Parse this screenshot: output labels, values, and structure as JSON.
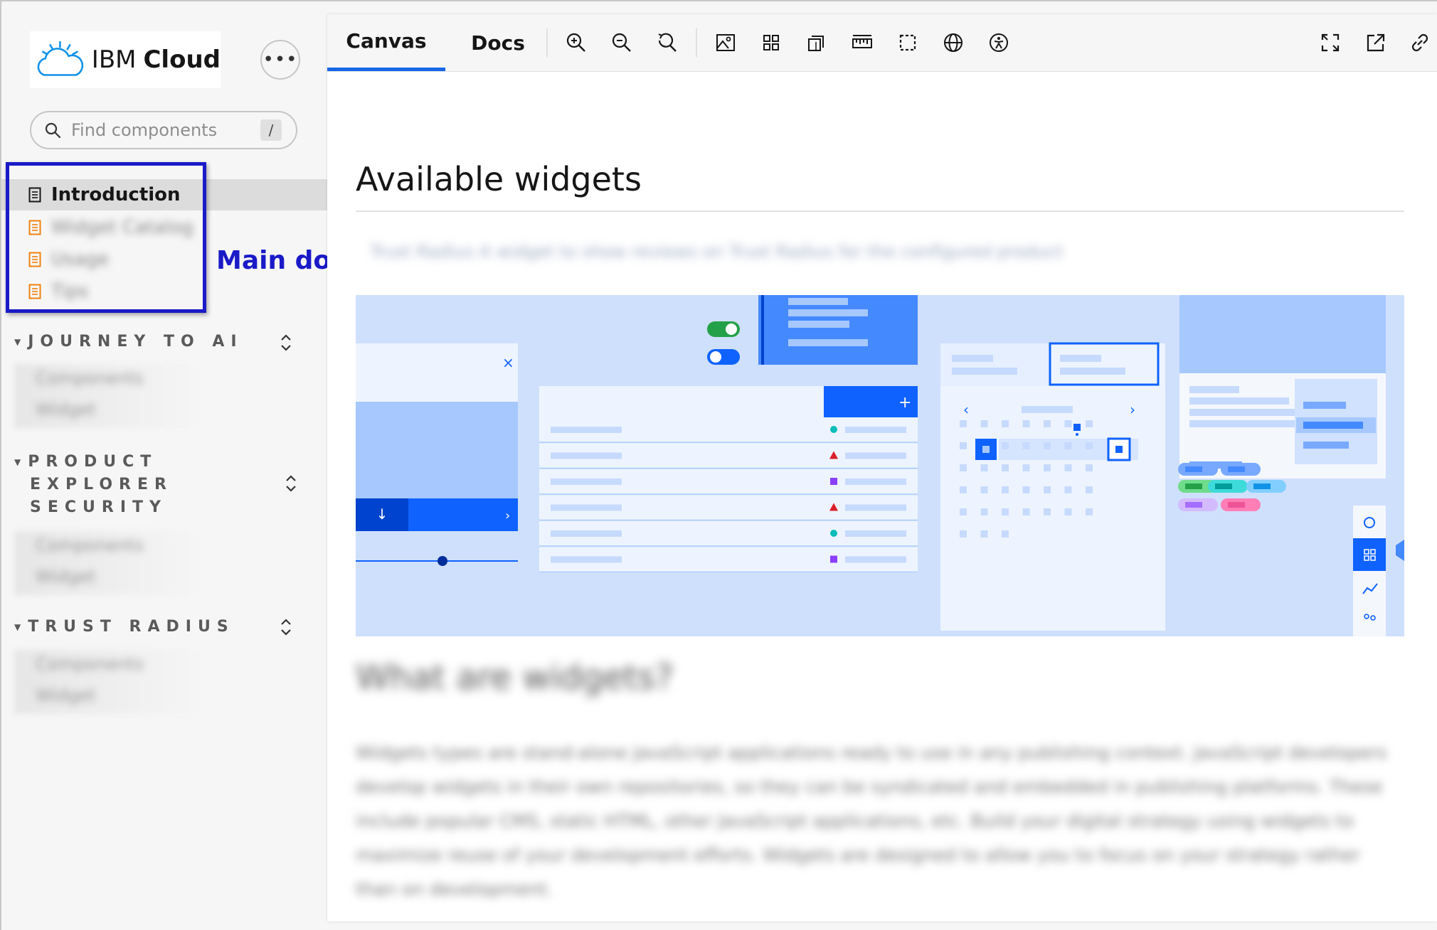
{
  "brand": {
    "ibm": "IBM",
    "cloud": "Cloud"
  },
  "search": {
    "placeholder": "Find components",
    "shortcut": "/"
  },
  "nav": {
    "items": [
      {
        "label": "Introduction",
        "active": true
      },
      {
        "label": "Widget Catalog"
      },
      {
        "label": "Usage"
      },
      {
        "label": "Tips"
      }
    ]
  },
  "annotation": "Main documentation section",
  "sections": [
    {
      "title": "JOURNEY TO AI",
      "items": [
        "Components",
        "Widget"
      ]
    },
    {
      "title_lines": [
        "PRODUCT",
        "EXPLORER",
        "SECURITY"
      ],
      "items": [
        "Components",
        "Widget"
      ]
    },
    {
      "title": "TRUST RADIUS",
      "items": [
        "Components",
        "Widget"
      ]
    }
  ],
  "toolbar": {
    "tabs": [
      "Canvas",
      "Docs"
    ],
    "tools": [
      "zoom-in-icon",
      "zoom-out-icon",
      "reset-zoom-icon",
      "background-icon",
      "grid-icon",
      "viewport-icon",
      "measure-icon",
      "outline-icon",
      "globe-icon",
      "accessibility-icon"
    ],
    "right_tools": [
      "fullscreen-icon",
      "open-new-tab-icon",
      "copy-link-icon"
    ]
  },
  "content": {
    "title": "Available widgets",
    "blurred_line": "Trust Radius  A widget to show reviews on Trust Radius for the configured product",
    "section_heading": "What are widgets?",
    "paragraph": "Widgets types are stand-alone JavaScript applications ready to use in any publishing context. JavaScript developers develop widgets in their own repositories, so they can be syndicated and embedded in publishing platforms. These include popular CMS, static HTML, other JavaScript applications, etc. Build your digital strategy using widgets to maximize reuse of your development efforts. Widgets are designed to allow you to focus on your strategy rather than on development."
  },
  "colors": {
    "accent": "#0f62fe",
    "annotation": "#1a1ac8",
    "hero_bg": "#cfe0fc"
  }
}
